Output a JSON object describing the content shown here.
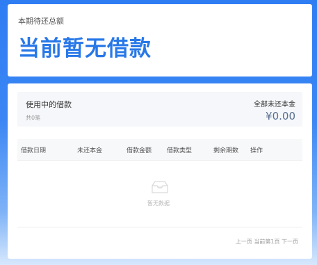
{
  "summary": {
    "label": "本期待还总额",
    "value": "当前暂无借款"
  },
  "loans": {
    "title": "使用中的借款",
    "count": "共0笔",
    "principal_label": "全部未还本金",
    "principal_value": "¥0.00"
  },
  "table": {
    "columns": [
      "借款日期",
      "未还本金",
      "借款金额",
      "借款类型",
      "剩余期数",
      "操作"
    ],
    "empty_text": "暂无数据"
  },
  "pagination": {
    "prev": "上一页",
    "current": "当前第1页",
    "next": "下一页"
  },
  "colors": {
    "accent": "#2878e8",
    "background": "#3a86f4"
  },
  "icons": {
    "empty": "empty-inbox-icon"
  }
}
